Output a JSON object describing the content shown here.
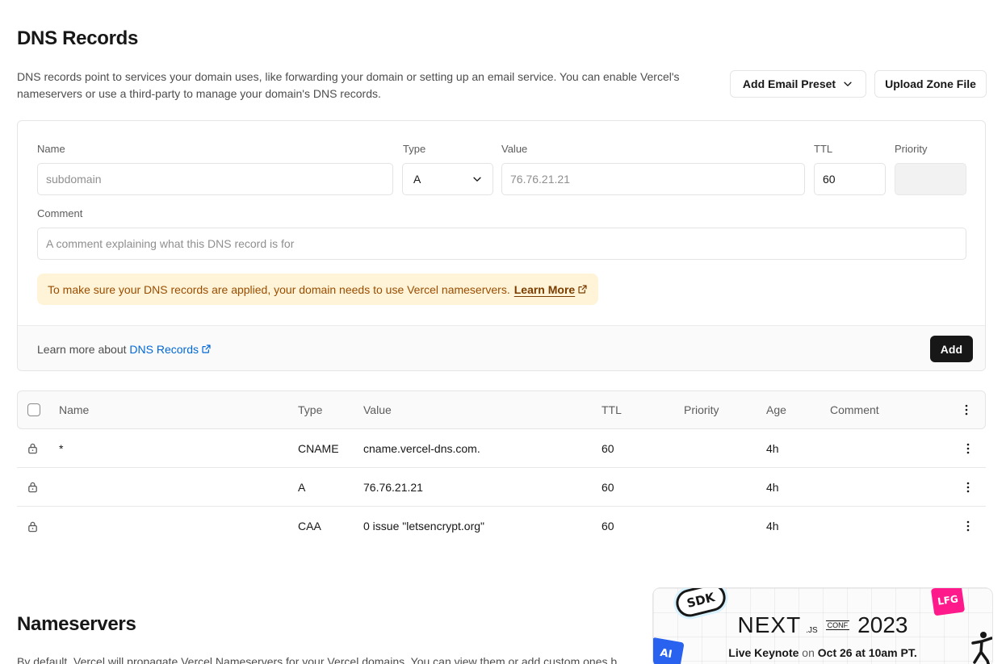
{
  "page": {
    "title": "DNS Records",
    "description": "DNS records point to services your domain uses, like forwarding your domain or setting up an email service. You can enable Vercel's nameservers or use a third-party to manage your domain's DNS records."
  },
  "actions": {
    "add_email_preset": "Add Email Preset",
    "upload_zone_file": "Upload Zone File"
  },
  "form": {
    "name_label": "Name",
    "name_placeholder": "subdomain",
    "type_label": "Type",
    "type_value": "A",
    "value_label": "Value",
    "value_placeholder": "76.76.21.21",
    "ttl_label": "TTL",
    "ttl_value": "60",
    "priority_label": "Priority",
    "comment_label": "Comment",
    "comment_placeholder": "A comment explaining what this DNS record is for",
    "notice_text": "To make sure your DNS records are applied, your domain needs to use Vercel nameservers.",
    "notice_link": "Learn More",
    "footer_text": "Learn more about",
    "footer_link": "DNS Records",
    "add_button": "Add"
  },
  "table": {
    "columns": [
      "Name",
      "Type",
      "Value",
      "TTL",
      "Priority",
      "Age",
      "Comment"
    ],
    "rows": [
      {
        "name": "*",
        "type": "CNAME",
        "value": "cname.vercel-dns.com.",
        "ttl": "60",
        "priority": "",
        "age": "4h",
        "comment": ""
      },
      {
        "name": "",
        "type": "A",
        "value": "76.76.21.21",
        "ttl": "60",
        "priority": "",
        "age": "4h",
        "comment": ""
      },
      {
        "name": "",
        "type": "CAA",
        "value": "0 issue \"letsencrypt.org\"",
        "ttl": "60",
        "priority": "",
        "age": "4h",
        "comment": ""
      }
    ]
  },
  "nameservers": {
    "title": "Nameservers",
    "description": "By default, Vercel will propagate Vercel Nameservers for your Vercel domains. You can view them or add custom ones b"
  },
  "promo": {
    "sticker_sdk": "SDK",
    "sticker_lfg": "LFG",
    "sticker_ai": "AI",
    "logo_next": "NEXT",
    "logo_js": ".JS",
    "logo_conf": "CONF",
    "logo_year": "2023",
    "sub_event": "Live Keynote",
    "sub_on": "on",
    "sub_date": "Oct 26 at 10am PT."
  },
  "colors": {
    "text": "#171717",
    "muted": "#5c5c5c",
    "link": "#0068d6",
    "notice_bg": "#fff4d8",
    "notice_text": "#9a4d00",
    "primary_button": "#171717"
  }
}
